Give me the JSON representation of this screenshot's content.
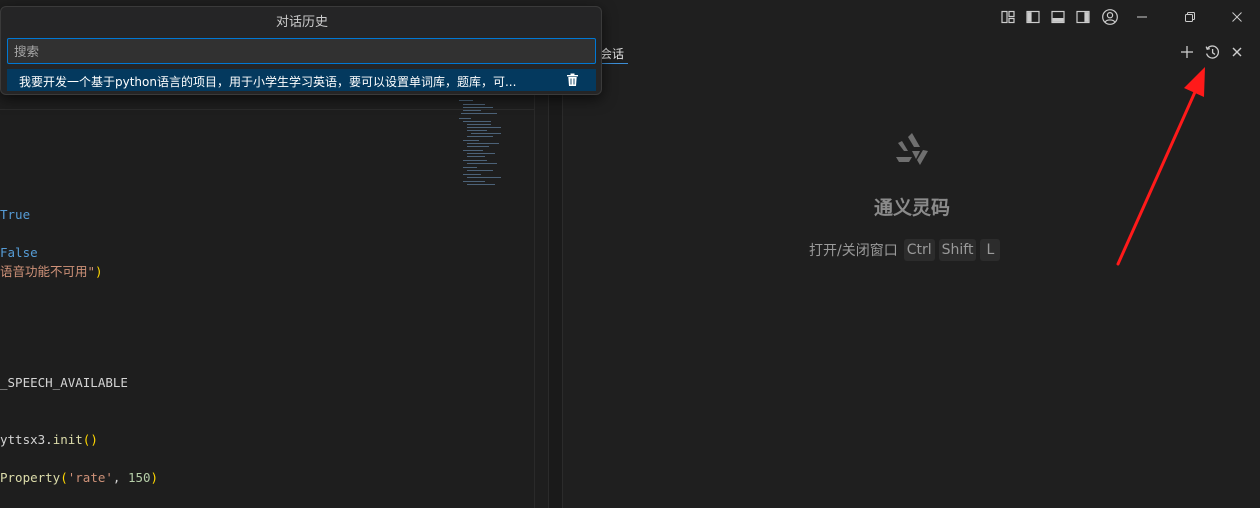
{
  "history_popup": {
    "title": "对话历史",
    "search_placeholder": "搜索",
    "items": [
      {
        "text": "我要开发一个基于python语言的项目，用于小学生学习英语，要可以设置单词库，题库，可..."
      }
    ]
  },
  "panel": {
    "tab_label": "会话",
    "brand_name": "通义灵码",
    "shortcut_label": "打开/关闭窗口",
    "shortcut_keys": [
      "Ctrl",
      "Shift",
      "L"
    ]
  },
  "editor": {
    "lines": [
      {
        "kw": "True"
      },
      {
        "kw": "False"
      },
      {
        "str": "语音功能不可用\"",
        "punc": ")"
      },
      {
        "text": "_SPEECH_AVAILABLE"
      },
      {
        "text": "yttsx3.",
        "fn": "init",
        "punc": "()"
      },
      {
        "fn": "Property",
        "punc_open": "(",
        "str": "'rate'",
        "sep": ", ",
        "num": "150",
        "punc_close": ")"
      }
    ]
  },
  "icons": {
    "titlebar": [
      "customize-layout-icon",
      "toggle-primary-sidebar-icon",
      "toggle-panel-icon",
      "toggle-secondary-sidebar-icon",
      "account-icon",
      "minimize-icon",
      "restore-icon",
      "close-icon"
    ],
    "panel": [
      "new-chat-icon",
      "history-icon",
      "close-panel-icon"
    ],
    "popup": [
      "trash-icon"
    ]
  },
  "colors": {
    "accent": "#0078d4",
    "selection": "#04395e",
    "annotation_arrow": "#ff1a1a"
  }
}
